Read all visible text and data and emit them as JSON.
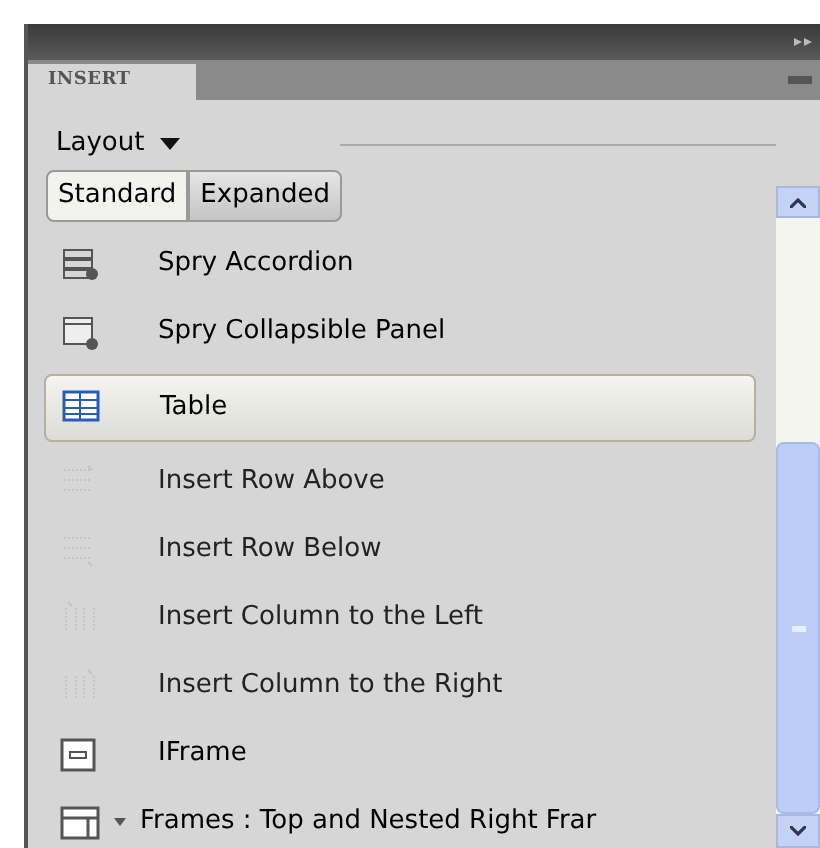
{
  "panel_tab": {
    "label": "INSERT",
    "selected": true
  },
  "category": {
    "label": "Layout"
  },
  "mode_buttons": [
    {
      "label": "Standard",
      "selected": true
    },
    {
      "label": "Expanded",
      "selected": false
    }
  ],
  "items": [
    {
      "label": "Spry Accordion",
      "kind": "accordion",
      "selected": false,
      "disabled": false
    },
    {
      "label": "Spry Collapsible Panel",
      "kind": "collapsible",
      "selected": false,
      "disabled": false
    },
    {
      "label": "Table",
      "kind": "table",
      "selected": true,
      "disabled": false
    },
    {
      "label": "Insert Row Above",
      "kind": "row-above",
      "selected": false,
      "disabled": true
    },
    {
      "label": "Insert Row Below",
      "kind": "row-below",
      "selected": false,
      "disabled": true
    },
    {
      "label": "Insert Column to the Left",
      "kind": "col-left",
      "selected": false,
      "disabled": true
    },
    {
      "label": "Insert Column to the Right",
      "kind": "col-right",
      "selected": false,
      "disabled": true
    },
    {
      "label": "IFrame",
      "kind": "iframe",
      "selected": false,
      "disabled": false
    },
    {
      "label": "Frames : Top and Nested Right Frar",
      "kind": "frames",
      "selected": false,
      "disabled": false
    }
  ]
}
